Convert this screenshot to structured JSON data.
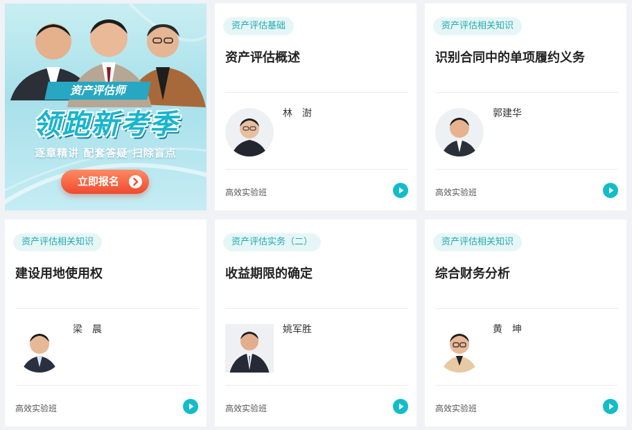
{
  "banner": {
    "subtitle": "资产评估师",
    "headline": "领跑新考季",
    "slogan": "逐章精讲  配套答疑  扫除盲点",
    "cta_label": "立即报名",
    "cta_icon": "chevron-right-icon",
    "colors": {
      "accent": "#17b5cf",
      "cta": "#ee4a2e"
    }
  },
  "courses": [
    {
      "tag": "资产评估基础",
      "title": "资产评估概述",
      "teacher": "林　澍",
      "class": "高效实验班"
    },
    {
      "tag": "资产评估相关知识",
      "title": "识别合同中的单项履约义务",
      "teacher": "郭建华",
      "class": "高效实验班"
    },
    {
      "tag": "资产评估相关知识",
      "title": "建设用地使用权",
      "teacher": "梁　晨",
      "class": "高效实验班"
    },
    {
      "tag": "资产评估实务（二）",
      "title": "收益期限的确定",
      "teacher": "姚军胜",
      "class": "高效实验班"
    },
    {
      "tag": "资产评估相关知识",
      "title": "综合财务分析",
      "teacher": "黄　坤",
      "class": "高效实验班"
    }
  ],
  "theme": {
    "tag_bg": "#e6f6f6",
    "tag_text": "#22a9b1",
    "play": "#13bcc9"
  }
}
